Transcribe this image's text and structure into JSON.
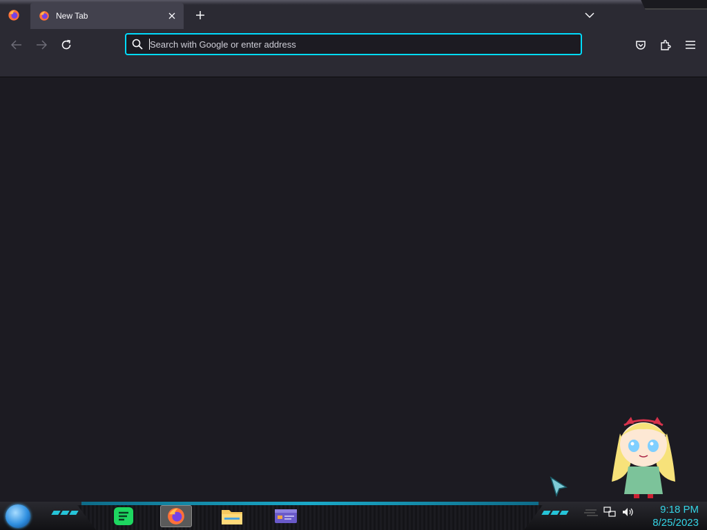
{
  "browser": {
    "tab": {
      "title": "New Tab",
      "close_icon": "close-icon"
    },
    "new_tab_icon": "plus-icon",
    "tab_list_icon": "chevron-down-icon",
    "urlbar": {
      "placeholder": "Search with Google or enter address",
      "value": ""
    },
    "toolbar_icons": [
      "back-icon",
      "forward-icon",
      "reload-icon",
      "pocket-icon",
      "extensions-icon",
      "menu-icon"
    ]
  },
  "taskbar": {
    "apps": [
      "spotify",
      "firefox",
      "file-explorer",
      "id-card-app"
    ],
    "tray_icons": [
      "network-icon",
      "volume-icon"
    ],
    "clock": {
      "time": "9:18 PM",
      "date": "8/25/2023"
    }
  },
  "colors": {
    "accent": "#00ddff",
    "chrome": "#2b2a33",
    "tab_active": "#42414d",
    "content_bg": "#1c1b22",
    "clock": "#34d5e6"
  }
}
